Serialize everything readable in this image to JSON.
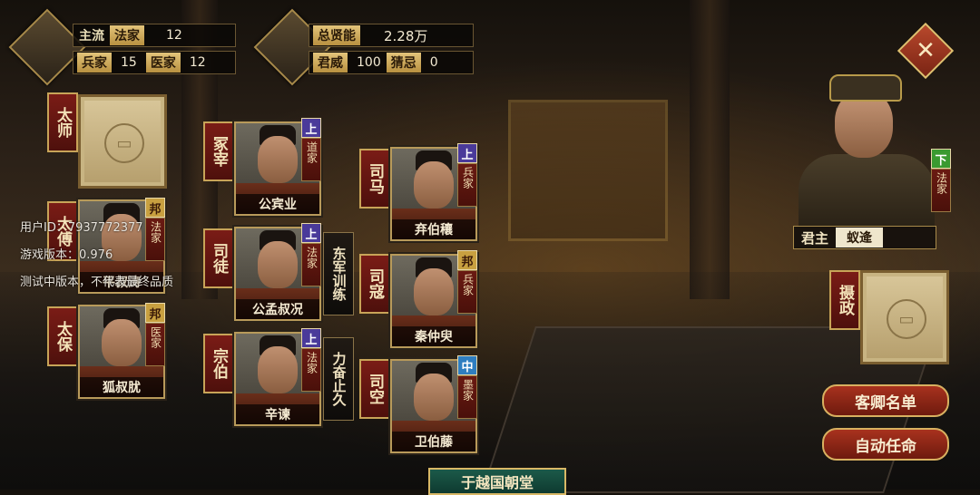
{
  "stats_left": {
    "row1_label": "主流",
    "row1_tag": "法家",
    "row1_value": "12",
    "row2_tag1": "兵家",
    "row2_value1": "15",
    "row2_tag2": "医家",
    "row2_value2": "12"
  },
  "stats_right": {
    "row1_label": "总贤能",
    "row1_value": "2.28万",
    "row2_label1": "君威",
    "row2_value1": "100",
    "row2_label2": "猜忌",
    "row2_value2": "0"
  },
  "left_officials": [
    {
      "title": "太师",
      "empty": true
    },
    {
      "title": "太傅",
      "name": "平叔涛",
      "grade": "邦",
      "school": "法家"
    },
    {
      "title": "太保",
      "name": "狐叔肬",
      "grade": "邦",
      "school": "医家"
    }
  ],
  "mid_officials": [
    {
      "title": "冢宰",
      "name": "公宾业",
      "grade": "上",
      "school": "道家"
    },
    {
      "title": "司徒",
      "name": "公孟叔况",
      "grade": "上",
      "school": "法家",
      "policy": "东军训练"
    },
    {
      "title": "宗伯",
      "name": "辛谏",
      "grade": "上",
      "school": "法家",
      "policy": "力奋止久"
    }
  ],
  "right_officials": [
    {
      "title": "司马",
      "name": "弃伯穰",
      "grade": "上",
      "school": "兵家"
    },
    {
      "title": "司寇",
      "name": "秦仲臾",
      "grade": "邦",
      "school": "兵家"
    },
    {
      "title": "司空",
      "name": "卫伯藤",
      "grade": "中",
      "school": "墨家"
    }
  ],
  "ruler": {
    "grade": "下",
    "school": "法家",
    "label": "君主",
    "name": "蚁逄"
  },
  "regent": {
    "title": "摄政",
    "empty": true
  },
  "overlay": {
    "user_id": "用户ID：7937772377",
    "version": "游戏版本：0.976",
    "notice": "测试中版本，不代表最终品质"
  },
  "buttons": {
    "close": "✕",
    "guest_list": "客卿名单",
    "auto_assign": "自动任命"
  },
  "court_banner": "于越国朝堂",
  "colors": {
    "accent_gold": "#c8a458",
    "title_red": "#7a1c16",
    "grade_up": "#4a3a9a",
    "grade_bang": "#c8a040",
    "grade_mid": "#2f7ec0",
    "grade_low": "#3a9a30"
  }
}
